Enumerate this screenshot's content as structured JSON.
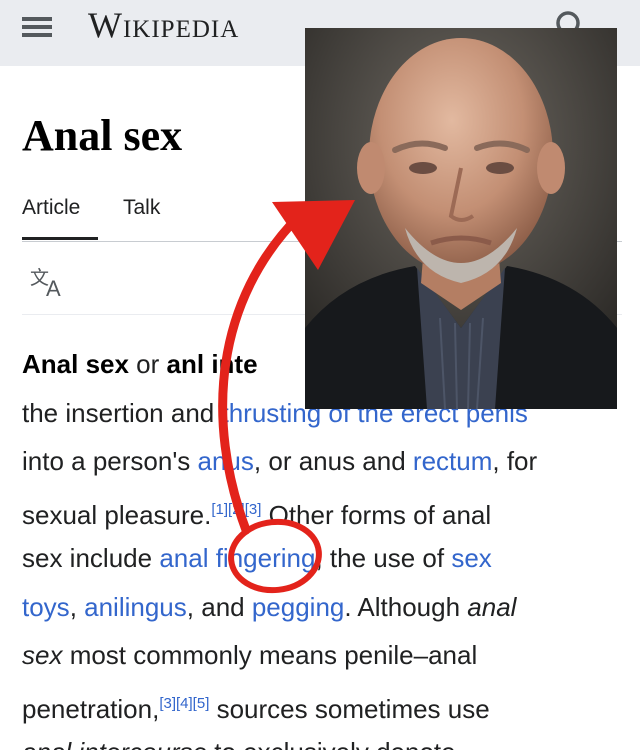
{
  "header": {
    "wordmark": "Wikipedia",
    "menu_icon": "hamburger-menu-icon",
    "search_icon": "search-icon"
  },
  "article": {
    "title": "Anal sex",
    "tabs": [
      {
        "label": "Article",
        "active": true
      },
      {
        "label": "Talk",
        "active": false
      }
    ],
    "language_icon": "translate-icon",
    "lines": {
      "l1": {
        "bold": "Anal sex",
        "a": " or ",
        "bold2": "an",
        "b": "l inte"
      },
      "l2": {
        "a": "the insertion an",
        "b": "d ",
        "link": "thrusting of the erect penis"
      },
      "l3": {
        "a": "into a person's ",
        "link1": "anus",
        "b": ", or anus and ",
        "link2": "rectum",
        "c": ", for"
      },
      "l4": {
        "a": "sexual pleasure.",
        "cite": "[1][2][3]",
        "b": " Other forms of anal"
      },
      "l5": {
        "a": "sex include ",
        "link1": "anal fingering",
        "b": ", the use of ",
        "link2": "sex"
      },
      "l6": {
        "link1": "toys",
        "a": ", ",
        "link2": "anilingus",
        "b": ", and ",
        "link3": "pegging",
        "c": ". Although ",
        "em": "anal"
      },
      "l7": {
        "em": "sex",
        "a": " most commonly means penile–anal"
      },
      "l8": {
        "a": "penetration,",
        "cite": "[3][4][5]",
        "b": " sources sometimes use"
      },
      "l9": {
        "em": "anal intercourse",
        "a": " to exclusively denote"
      }
    }
  },
  "overlay": {
    "photo": "man-portrait-photo",
    "arrow_color": "#e3231b",
    "circle_color": "#e3231b"
  },
  "colors": {
    "link": "#3366cc",
    "text": "#202122",
    "topbar": "#eaecf0"
  }
}
